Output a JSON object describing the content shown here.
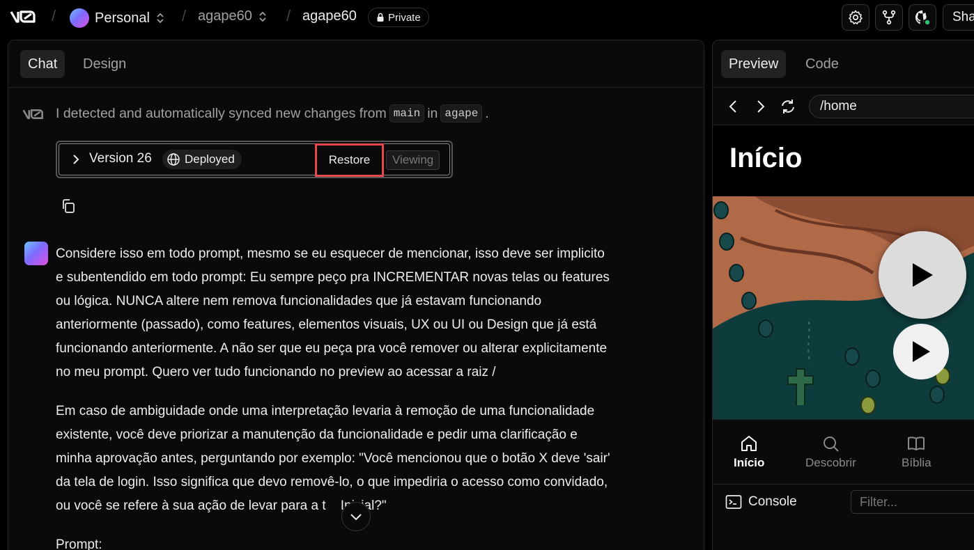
{
  "topbar": {
    "workspace": "Personal",
    "project": "agape60",
    "chat_name": "agape60",
    "visibility": "Private",
    "share_label": "Sha"
  },
  "chat_tabs": [
    {
      "label": "Chat",
      "active": true
    },
    {
      "label": "Design",
      "active": false
    }
  ],
  "sync_message": {
    "prefix": "I detected and automatically synced new changes from",
    "branch": "main",
    "connector": "in",
    "repo": "agape",
    "suffix": "."
  },
  "version_card": {
    "label": "Version 26",
    "status": "Deployed",
    "restore_label": "Restore",
    "viewing_label": "Viewing"
  },
  "prompt": {
    "paragraphs": [
      "Considere isso em todo prompt, mesmo se eu esquecer de mencionar, isso deve ser implicito\ne subentendido em todo prompt: Eu sempre peço pra INCREMENTAR novas telas ou features\nou lógica. NUNCA altere nem remova funcionalidades que já estavam funcionando\nanteriormente (passado), como features, elementos visuais, UX ou UI ou Design que já está\nfuncionando anteriormente. A não ser que eu peça pra você remover ou alterar explicitamente\nno meu prompt. Quero ver tudo funcionando no preview ao acessar a raiz /",
      "Em caso de ambiguidade onde uma interpretação levaria à remoção de uma funcionalidade\nexistente, você deve priorizar a manutenção da funcionalidade e pedir uma clarificação e\nminha aprovação antes, perguntando por exemplo: \"Você mencionou que o botão X deve 'sair'\nda tela de login. Isso significa que devo removê-lo, o que impediria o acesso como convidado,\nou você se refere à sua ação de levar para a t    Inicial?\"",
      "Prompt:"
    ]
  },
  "preview_tabs": [
    {
      "label": "Preview",
      "active": true
    },
    {
      "label": "Code",
      "active": false
    }
  ],
  "url": "/home",
  "app": {
    "title": "Início",
    "nav": [
      {
        "label": "Início",
        "icon": "home-icon",
        "active": true
      },
      {
        "label": "Descobrir",
        "icon": "search-icon",
        "active": false
      },
      {
        "label": "Bíblia",
        "icon": "book-icon",
        "active": false
      }
    ]
  },
  "console": {
    "label": "Console",
    "filter_placeholder": "Filter..."
  },
  "colors": {
    "background": "#000000",
    "panel": "#0a0a0a",
    "border": "#262626",
    "highlight": "#e5484d",
    "text_muted": "#a1a1a1"
  }
}
